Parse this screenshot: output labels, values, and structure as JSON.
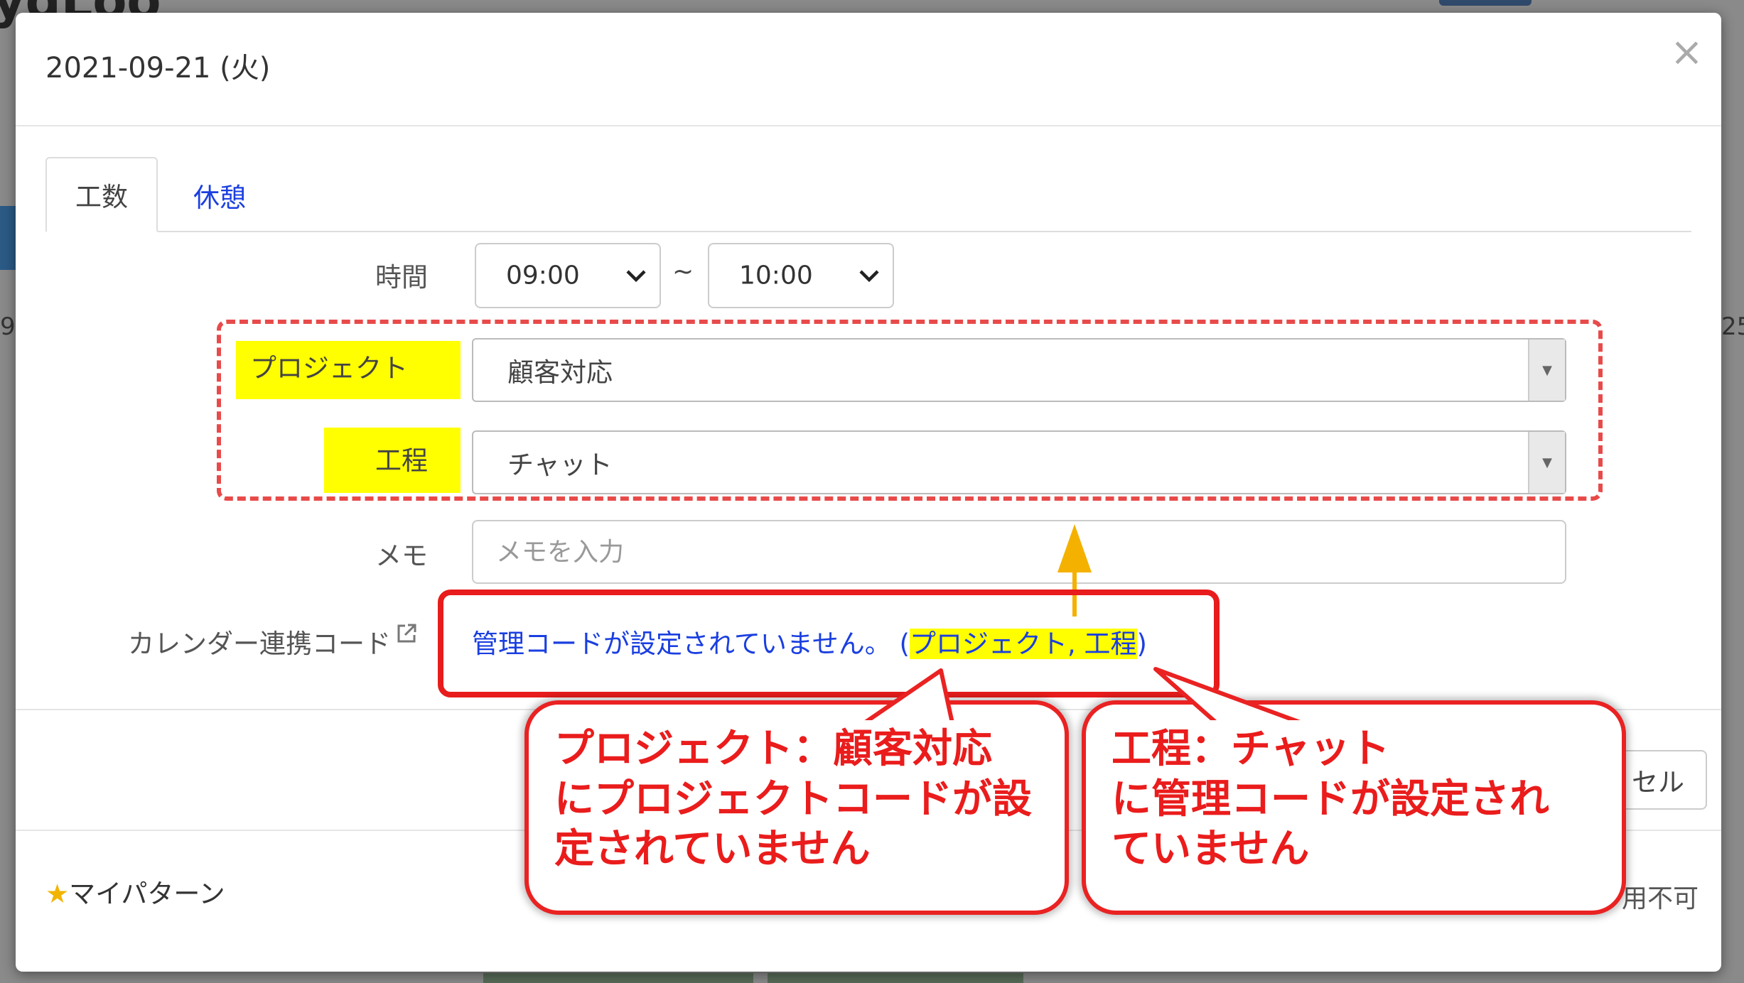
{
  "dialog": {
    "title": "2021-09-21 (火)",
    "close_label": "×",
    "tabs": [
      {
        "label": "工数",
        "active": true
      },
      {
        "label": "休憩",
        "active": false
      }
    ],
    "time": {
      "label": "時間",
      "start": "09:00",
      "separator": "~",
      "end": "10:00"
    },
    "project": {
      "label": "プロジェクト",
      "value": "顧客対応"
    },
    "process": {
      "label": "工程",
      "value": "チャット"
    },
    "memo": {
      "label": "メモ",
      "placeholder": "メモを入力"
    },
    "calendar_code": {
      "label": "カレンダー連携コード",
      "message": "管理コードが設定されていません。 (",
      "highlight": "プロジェクト, 工程",
      "close_paren": ")"
    },
    "cancel_label": "セル",
    "my_pattern": {
      "star": "★",
      "label": "マイパターン"
    },
    "unavailable_label": "用不可"
  },
  "annotations": {
    "bubble_left": [
      "プロジェクト：顧客対応",
      "にプロジェクトコードが設",
      "定されていません"
    ],
    "bubble_right": [
      "工程：チャット",
      "に管理コードが設定され",
      "ていません"
    ],
    "highlight_color": "#ffff00",
    "annotation_color": "#ea1c1c",
    "arrow_color": "#f5b100"
  }
}
